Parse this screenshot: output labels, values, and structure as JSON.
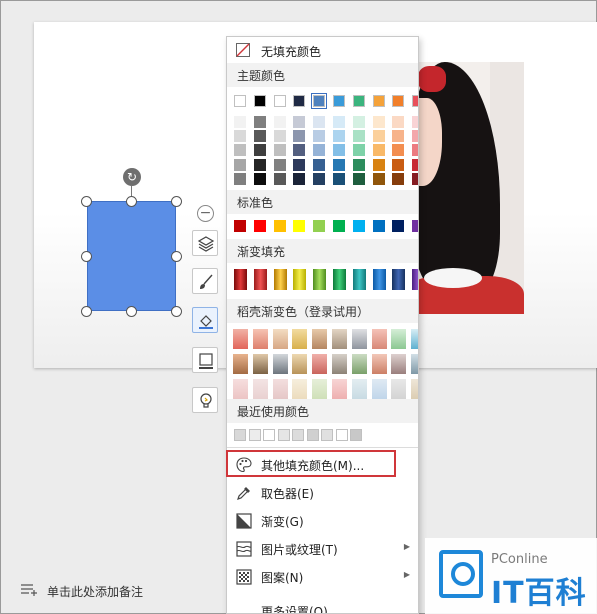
{
  "menu": {
    "no_fill_label": "无填充颜色",
    "theme_colors_title": "主题颜色",
    "theme_colors_top": [
      "#ffffff",
      "#000000",
      "#ffffff",
      "#1f2a44",
      "#4f81bd",
      "#3a9bd9",
      "#3bb47e",
      "#f4a23a",
      "#f17f2a",
      "#e8505b"
    ],
    "theme_colors_shades": [
      [
        "#f2f2f2",
        "#7f7f7f",
        "#f2f2f2",
        "#c6cad6",
        "#dbe5f1",
        "#d6eaf7",
        "#d4f0e2",
        "#fde7cd",
        "#fbd9c4",
        "#f9d3d5"
      ],
      [
        "#d9d9d9",
        "#595959",
        "#d9d9d9",
        "#8c96ae",
        "#b8cce4",
        "#acd4ef",
        "#a9e1c5",
        "#fbd09b",
        "#f7b38a",
        "#f3a7ab"
      ],
      [
        "#bfbfbf",
        "#3f3f3f",
        "#bfbfbf",
        "#535f80",
        "#95b3d7",
        "#83bfe7",
        "#7ed2a8",
        "#f9b968",
        "#f38e50",
        "#ec7b81"
      ],
      [
        "#a6a6a6",
        "#262626",
        "#808080",
        "#2d3a5c",
        "#366092",
        "#2678b3",
        "#2c8d5d",
        "#d88211",
        "#c95c12",
        "#c72a35"
      ],
      [
        "#7f7f7f",
        "#0d0d0d",
        "#595959",
        "#1b2438",
        "#244062",
        "#1a5077",
        "#1e5e3e",
        "#90560b",
        "#863d0c",
        "#851c23"
      ]
    ],
    "standard_colors_title": "标准色",
    "standard_colors": [
      "#c00000",
      "#ff0000",
      "#ffc000",
      "#ffff00",
      "#92d050",
      "#00b050",
      "#00b0f0",
      "#0070c0",
      "#002060",
      "#7030a0"
    ],
    "gradient_fill_title": "渐变填充",
    "gradient_fill": [
      [
        "#7a0a0a",
        "#e23b3b"
      ],
      [
        "#9b1c1c",
        "#f05555"
      ],
      [
        "#b37a00",
        "#ffd24d"
      ],
      [
        "#b8b000",
        "#f4ee4a"
      ],
      [
        "#4f8d1f",
        "#a6df5c"
      ],
      [
        "#0c7a3a",
        "#3fcf7a"
      ],
      [
        "#137a7a",
        "#3cc5c5"
      ],
      [
        "#0b5aa6",
        "#3f95e6"
      ],
      [
        "#17315e",
        "#3f66b3"
      ],
      [
        "#4b1f80",
        "#9157d1"
      ]
    ],
    "docer_gradient_title": "稻壳渐变色（登录试用）",
    "docer_gradient": [
      [
        [
          "#f1b2a6",
          "#e2655a"
        ],
        [
          "#f6c3b3",
          "#de7f6c"
        ],
        [
          "#f3dcc2",
          "#d7a784"
        ],
        [
          "#f2dba0",
          "#d8b04c"
        ],
        [
          "#e7c9a9",
          "#b58661"
        ],
        [
          "#e3d5c4",
          "#a2907c"
        ],
        [
          "#dfe0e3",
          "#8f959e"
        ],
        [
          "#f5c2b8",
          "#d88877"
        ],
        [
          "#d5eed7",
          "#8cc892"
        ],
        [
          "#d8eef5",
          "#5fb0d0"
        ]
      ],
      [
        [
          "#e8b38e",
          "#a36b43"
        ],
        [
          "#e0c8a8",
          "#7c6245"
        ],
        [
          "#d3d7db",
          "#6d757d"
        ],
        [
          "#edd8b1",
          "#b89359"
        ],
        [
          "#f0b0aa",
          "#c9645c"
        ],
        [
          "#d6d0c8",
          "#8c8276"
        ],
        [
          "#cbdbc3",
          "#7aa06a"
        ],
        [
          "#f2c7b8",
          "#cc7f66"
        ],
        [
          "#ddd0cf",
          "#9a7f7d"
        ],
        [
          "#d2dfe6",
          "#7f98a6"
        ]
      ],
      [
        [
          "#f6dede",
          "#ecc4c4"
        ],
        [
          "#f3e3e3",
          "#e9d1d1"
        ],
        [
          "#f3dede",
          "#e5c7c7"
        ],
        [
          "#f6eedd",
          "#ecdcbd"
        ],
        [
          "#e6efd9",
          "#cfe0b8"
        ],
        [
          "#f7d5d5",
          "#eeb0b0"
        ],
        [
          "#e3edf1",
          "#c8dbe3"
        ],
        [
          "#dfeaf3",
          "#c0d6ea"
        ],
        [
          "#e8e8e8",
          "#d4d4d4"
        ],
        [
          "#eee6d8",
          "#dccdb2"
        ]
      ]
    ],
    "recent_colors_title": "最近使用颜色",
    "recent_colors": [
      "#d8d8d8",
      "#ececec",
      "#ffffff",
      "#e5e5e5",
      "#dcdcdc",
      "#d0d0d0",
      "#e0e0e0",
      "#ffffff",
      "#c8c8c8"
    ],
    "more_fill_label": "其他填充颜色(M)...",
    "eyedropper_label": "取色器(E)",
    "gradient_label": "渐变(G)",
    "picture_texture_label": "图片或纹理(T)",
    "pattern_label": "图案(N)",
    "more_settings_label": "更多设置(O)..."
  },
  "status_bar": {
    "add_note_text": "单击此处添加备注"
  },
  "watermark": {
    "brand_small": "PConline",
    "brand_big": "IT百科"
  },
  "colors": {
    "shape_fill": "#5b8ee6",
    "highlight_border": "#d0363a",
    "watermark_blue": "#1e7fd3"
  }
}
